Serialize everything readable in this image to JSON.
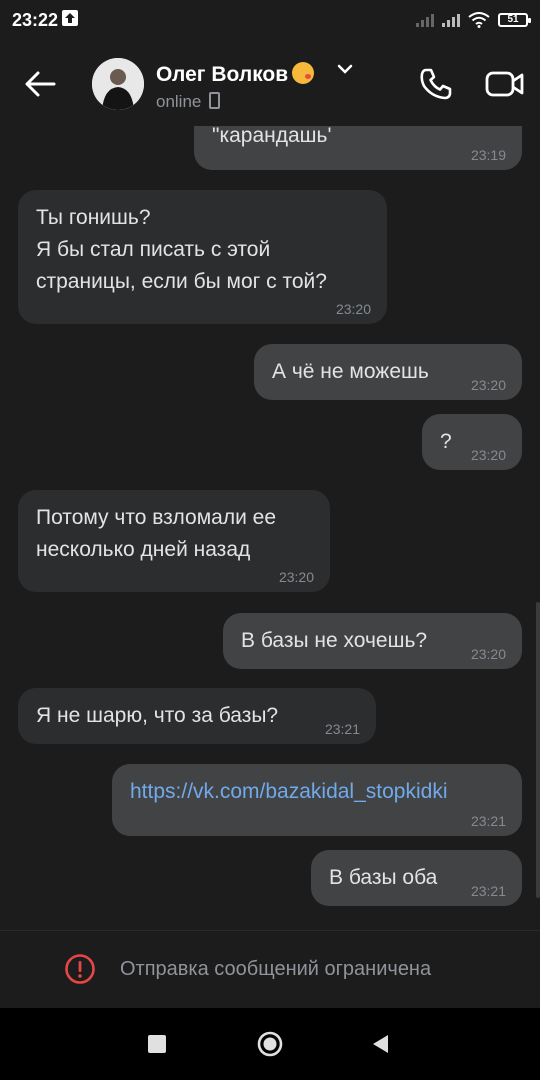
{
  "status_bar": {
    "time": "23:22",
    "battery": "51"
  },
  "header": {
    "name": "Олег Волков",
    "status": "online"
  },
  "messages": [
    {
      "dir": "out",
      "text": "\"карандашь'",
      "time": "23:19"
    },
    {
      "dir": "in",
      "text": "Ты гонишь?\nЯ бы стал писать с этой\nстраницы, если бы мог с той?",
      "time": "23:20"
    },
    {
      "dir": "out",
      "text": "А чё не можешь",
      "time": "23:20"
    },
    {
      "dir": "out",
      "text": "?",
      "time": "23:20"
    },
    {
      "dir": "in",
      "text": "Потому что взломали ее\nнесколько дней назад",
      "time": "23:20"
    },
    {
      "dir": "out",
      "text": "В базы не хочешь?",
      "time": "23:20"
    },
    {
      "dir": "in",
      "text": "Я не шарю, что за базы?",
      "time": "23:21"
    },
    {
      "dir": "out",
      "text": "https://vk.com/bazakidal_stopkidki",
      "time": "23:21",
      "is_link": true
    },
    {
      "dir": "out",
      "text": "В базы оба",
      "time": "23:21"
    }
  ],
  "footer": {
    "restricted_text": "Отправка сообщений ограничена"
  },
  "colors": {
    "background": "#1c1c1d",
    "incoming": "#2c2d2e",
    "outgoing": "#424344",
    "link": "#71aaeb",
    "warning": "#e64646"
  },
  "icons": [
    "arrow-back-icon",
    "chevron-down-icon",
    "phone-icon",
    "video-camera-icon",
    "warning-icon",
    "nav-recent-icon",
    "nav-home-icon",
    "nav-back-icon"
  ]
}
